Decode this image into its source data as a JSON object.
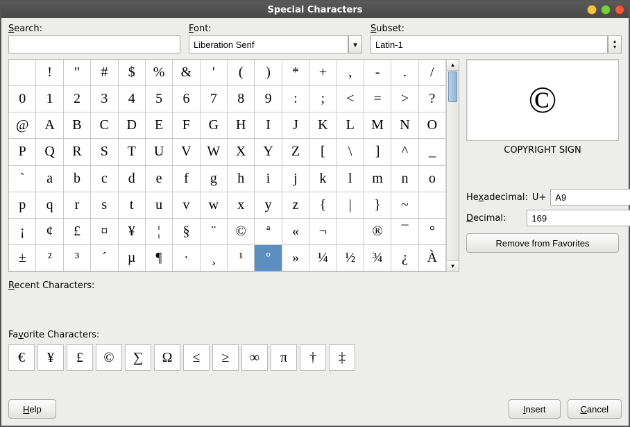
{
  "window": {
    "title": "Special Characters"
  },
  "labels": {
    "search": "Search:",
    "font": "Font:",
    "subset": "Subset:",
    "recent": "Recent Characters:",
    "favorite": "Favorite Characters:",
    "hex": "Hexadecimal:",
    "hex_prefix": "U+",
    "decimal": "Decimal:",
    "remove_fav": "Remove from Favorites",
    "help": "Help",
    "insert": "Insert",
    "cancel": "Cancel"
  },
  "underline": {
    "search": "S",
    "font": "F",
    "subset": "S",
    "recent": "R",
    "favorite": "v",
    "hex": "x",
    "decimal": "D",
    "help": "H",
    "insert": "I",
    "cancel": "C"
  },
  "values": {
    "search": "",
    "font": "Liberation Serif",
    "subset": "Latin-1",
    "hex": "A9",
    "decimal": "169",
    "preview_char": "©",
    "char_name": "COPYRIGHT SIGN"
  },
  "chart_data": {
    "type": "table",
    "columns": 16,
    "selected_index": 121,
    "cells": [
      " ",
      "!",
      "\"",
      "#",
      "$",
      "%",
      "&",
      "'",
      "(",
      ")",
      "*",
      "+",
      ",",
      "-",
      ".",
      "/",
      "0",
      "1",
      "2",
      "3",
      "4",
      "5",
      "6",
      "7",
      "8",
      "9",
      ":",
      ";",
      "<",
      "=",
      ">",
      "?",
      "@",
      "A",
      "B",
      "C",
      "D",
      "E",
      "F",
      "G",
      "H",
      "I",
      "J",
      "K",
      "L",
      "M",
      "N",
      "O",
      "P",
      "Q",
      "R",
      "S",
      "T",
      "U",
      "V",
      "W",
      "X",
      "Y",
      "Z",
      "[",
      "\\",
      "]",
      "^",
      "_",
      "`",
      "a",
      "b",
      "c",
      "d",
      "e",
      "f",
      "g",
      "h",
      "i",
      "j",
      "k",
      "l",
      "m",
      "n",
      "o",
      "p",
      "q",
      "r",
      "s",
      "t",
      "u",
      "v",
      "w",
      "x",
      "y",
      "z",
      "{",
      "|",
      "}",
      "~",
      " ",
      "¡",
      "¢",
      "£",
      "¤",
      "¥",
      "¦",
      "§",
      "¨",
      "©",
      "ª",
      "«",
      "¬",
      " ",
      "®",
      "¯",
      "°",
      "±",
      "²",
      "³",
      "´",
      "µ",
      "¶",
      "·",
      "¸",
      "¹",
      "º",
      "»",
      "¼",
      "½",
      "¾",
      "¿",
      "À"
    ]
  },
  "favorites": [
    "€",
    "¥",
    "£",
    "©",
    "∑",
    "Ω",
    "≤",
    "≥",
    "∞",
    "π",
    "†",
    "‡"
  ]
}
